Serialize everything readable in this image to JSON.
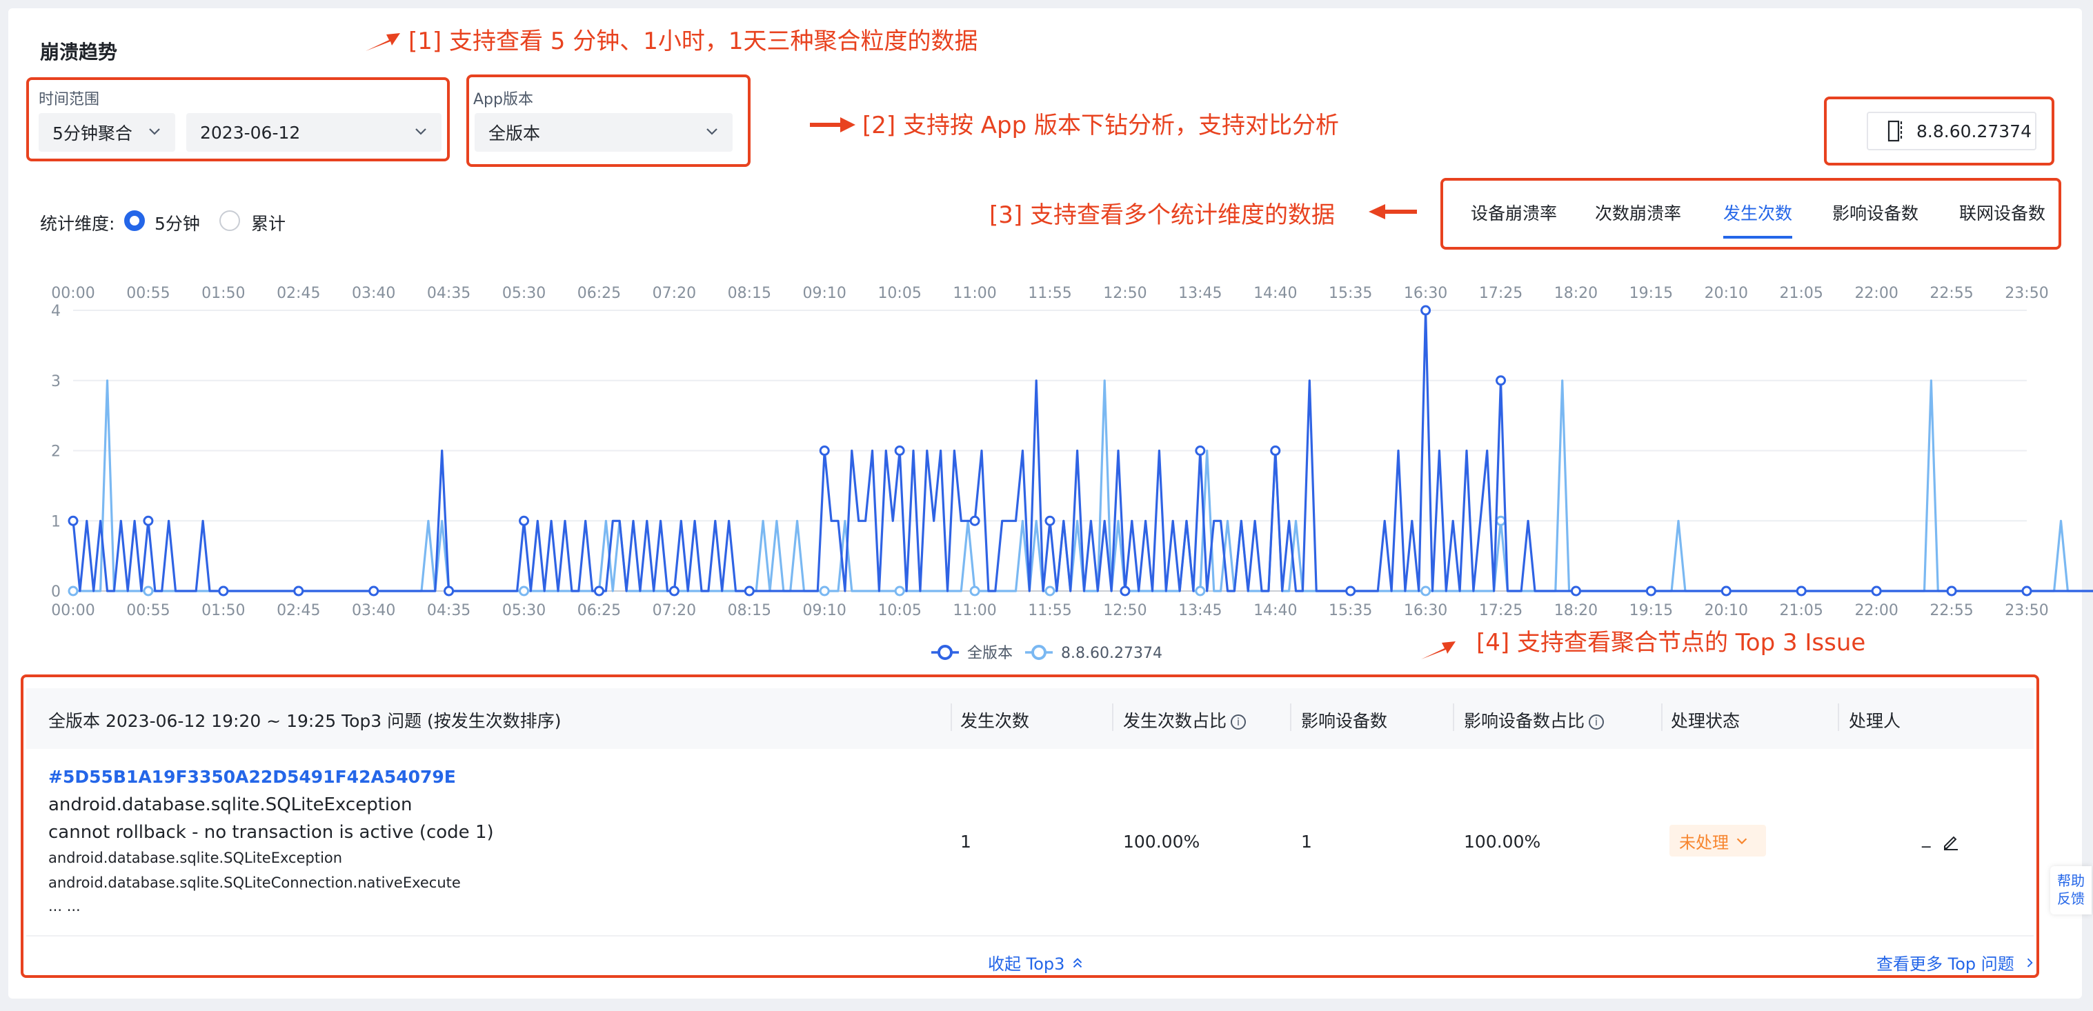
{
  "page": {
    "title": "崩溃趋势",
    "help_label_1": "帮助",
    "help_label_2": "反馈"
  },
  "filters": {
    "time_range_label": "时间范围",
    "granularity_value": "5分钟聚合",
    "date_value": "2023-06-12",
    "app_version_label": "App版本",
    "app_version_value": "全版本",
    "compare_version_value": "8.8.60.27374"
  },
  "stat_dimension": {
    "label": "统计维度:",
    "options": [
      "5分钟",
      "累计"
    ],
    "selected": "5分钟"
  },
  "tabs": [
    {
      "label": "设备崩溃率",
      "active": false
    },
    {
      "label": "次数崩溃率",
      "active": false
    },
    {
      "label": "发生次数",
      "active": true
    },
    {
      "label": "影响设备数",
      "active": false
    },
    {
      "label": "联网设备数",
      "active": false
    }
  ],
  "annotations": {
    "a1": "[1] 支持查看 5 分钟、1小时，1天三种聚合粒度的数据",
    "a2": "[2] 支持按 App 版本下钻分析，支持对比分析",
    "a3": "[3] 支持查看多个统计维度的数据",
    "a4": "[4] 支持查看聚合节点的 Top 3 Issue"
  },
  "colors": {
    "accent": "#2466e8",
    "series_all": "#2f63e4",
    "series_version": "#7ab8f2",
    "annotation": "#e8421f",
    "status_bg": "#fff3e8",
    "status_text": "#f7862f"
  },
  "chart_data": {
    "type": "line",
    "x_ticks": [
      "00:00",
      "00:55",
      "01:50",
      "02:45",
      "03:40",
      "04:35",
      "05:30",
      "06:25",
      "07:20",
      "08:15",
      "09:10",
      "10:05",
      "11:00",
      "11:55",
      "12:50",
      "13:45",
      "14:40",
      "15:35",
      "16:30",
      "17:25",
      "18:20",
      "19:15",
      "20:10",
      "21:05",
      "22:00",
      "22:55",
      "23:50"
    ],
    "ylim": [
      0,
      4
    ],
    "y_ticks": [
      0,
      1,
      2,
      3,
      4
    ],
    "grid": true,
    "legend": "bottom-center",
    "x_interval_minutes": 5,
    "series": [
      {
        "name": "全版本",
        "values": [
          1,
          0,
          1,
          0,
          1,
          0,
          0,
          1,
          0,
          1,
          0,
          1,
          0,
          0,
          1,
          0,
          0,
          0,
          0,
          1,
          0,
          0,
          0,
          0,
          0,
          0,
          0,
          0,
          0,
          0,
          0,
          0,
          0,
          0,
          0,
          0,
          0,
          0,
          0,
          0,
          0,
          0,
          0,
          0,
          0,
          0,
          0,
          0,
          0,
          0,
          0,
          0,
          0,
          0,
          2,
          0,
          0,
          0,
          0,
          0,
          0,
          0,
          0,
          0,
          0,
          0,
          1,
          0,
          1,
          0,
          1,
          0,
          1,
          0,
          0,
          1,
          0,
          0,
          0,
          1,
          1,
          0,
          1,
          0,
          1,
          0,
          1,
          0,
          0,
          1,
          0,
          1,
          0,
          0,
          1,
          0,
          1,
          0,
          0,
          0,
          0,
          0,
          0,
          0,
          0,
          0,
          0,
          0,
          0,
          0,
          2,
          1,
          1,
          0,
          2,
          1,
          1,
          2,
          0,
          2,
          1,
          2,
          0,
          2,
          0,
          2,
          1,
          2,
          0,
          2,
          1,
          1,
          1,
          2,
          0,
          0,
          1,
          1,
          1,
          2,
          0,
          3,
          0,
          1,
          0,
          1,
          0,
          2,
          0,
          1,
          0,
          1,
          0,
          2,
          0,
          1,
          0,
          1,
          0,
          2,
          0,
          1,
          0,
          1,
          0,
          2,
          0,
          1,
          1,
          0,
          0,
          1,
          0,
          1,
          0,
          0,
          2,
          0,
          1,
          0,
          0,
          3,
          0,
          0,
          0,
          0,
          0,
          0,
          0,
          0,
          0,
          0,
          1,
          0,
          2,
          0,
          1,
          0,
          4,
          0,
          2,
          0,
          1,
          0,
          2,
          0,
          1,
          2,
          0,
          3,
          0,
          0,
          0,
          1,
          0,
          0,
          0,
          0,
          0,
          0,
          0,
          0,
          0,
          0,
          0,
          0,
          0,
          0,
          0,
          0,
          0,
          0,
          0,
          0,
          0,
          0,
          0,
          0,
          0,
          0,
          0,
          0,
          0,
          0,
          0,
          0,
          0,
          0,
          0,
          0,
          0,
          0,
          0,
          0,
          0,
          0,
          0,
          0,
          0,
          0,
          0,
          0,
          0,
          0,
          0,
          0,
          0,
          0,
          0,
          0,
          0,
          0,
          0,
          0,
          0,
          0,
          0,
          0,
          0,
          0,
          0,
          0,
          0,
          0,
          0,
          0,
          0,
          0,
          0,
          0,
          0,
          0,
          0,
          0,
          0,
          0,
          0,
          0,
          0,
          0,
          0,
          0,
          0
        ]
      },
      {
        "name": "8.8.60.27374",
        "values": [
          0,
          0,
          0,
          0,
          0,
          3,
          0,
          0,
          0,
          0,
          0,
          0,
          0,
          0,
          0,
          0,
          0,
          0,
          0,
          0,
          0,
          0,
          0,
          0,
          0,
          0,
          0,
          0,
          0,
          0,
          0,
          0,
          0,
          0,
          0,
          0,
          0,
          0,
          0,
          0,
          0,
          0,
          0,
          0,
          0,
          0,
          0,
          0,
          0,
          0,
          0,
          0,
          1,
          0,
          1,
          0,
          0,
          0,
          0,
          0,
          0,
          0,
          0,
          0,
          0,
          0,
          0,
          0,
          0,
          0,
          0,
          0,
          0,
          0,
          0,
          0,
          0,
          0,
          1,
          0,
          1,
          0,
          0,
          0,
          0,
          0,
          0,
          0,
          0,
          0,
          0,
          0,
          0,
          0,
          0,
          0,
          0,
          0,
          0,
          0,
          0,
          1,
          0,
          1,
          0,
          0,
          1,
          0,
          0,
          0,
          0,
          0,
          0,
          1,
          0,
          0,
          0,
          0,
          0,
          0,
          0,
          0,
          0,
          0,
          0,
          0,
          0,
          0,
          0,
          0,
          0,
          1,
          0,
          0,
          0,
          0,
          0,
          0,
          0,
          1,
          0,
          1,
          0,
          0,
          0,
          1,
          0,
          1,
          0,
          0,
          0,
          3,
          0,
          1,
          0,
          0,
          0,
          0,
          0,
          0,
          0,
          0,
          0,
          1,
          0,
          0,
          2,
          0,
          0,
          1,
          0,
          1,
          0,
          0,
          0,
          0,
          2,
          0,
          0,
          1,
          0,
          0,
          0,
          0,
          0,
          0,
          0,
          0,
          0,
          0,
          0,
          0,
          0,
          0,
          0,
          0,
          0,
          0,
          0,
          0,
          0,
          0,
          0,
          0,
          0,
          0,
          0,
          0,
          0,
          1,
          0,
          0,
          0,
          0,
          0,
          0,
          0,
          0,
          3,
          0,
          0,
          0,
          0,
          0,
          0,
          0,
          0,
          0,
          0,
          0,
          0,
          0,
          0,
          0,
          0,
          1,
          0,
          0,
          0,
          0,
          0,
          0,
          0,
          0,
          0,
          0,
          0,
          0,
          0,
          0,
          0,
          0,
          0,
          0,
          0,
          0,
          0,
          0,
          0,
          0,
          0,
          0,
          0,
          0,
          0,
          0,
          0,
          0,
          0,
          0,
          0,
          0,
          3,
          0,
          0,
          0,
          0,
          0,
          0,
          0,
          0,
          0,
          0,
          0,
          0,
          0,
          0,
          0,
          0,
          0,
          0,
          1,
          0,
          0,
          0,
          0,
          0,
          0,
          0,
          0
        ]
      }
    ]
  },
  "issues_table": {
    "header_title": "全版本 2023-06-12 19:20 ~ 19:25 Top3 问题 (按发生次数排序)",
    "columns": [
      "发生次数",
      "发生次数占比",
      "影响设备数",
      "影响设备数占比",
      "处理状态",
      "处理人"
    ],
    "rows": [
      {
        "id": "#5D55B1A19F3350A22D5491F42A54079E",
        "exception": "android.database.sqlite.SQLiteException",
        "message": "cannot rollback - no transaction is active (code 1)",
        "stack_1": "android.database.sqlite.SQLiteException",
        "stack_2": "android.database.sqlite.SQLiteConnection.nativeExecute",
        "stack_more": "... ...",
        "count": "1",
        "count_ratio": "100.00%",
        "devices": "1",
        "devices_ratio": "100.00%",
        "status": "未处理",
        "handler": "_"
      }
    ],
    "collapse_label": "收起 Top3",
    "more_label": "查看更多 Top 问题"
  }
}
